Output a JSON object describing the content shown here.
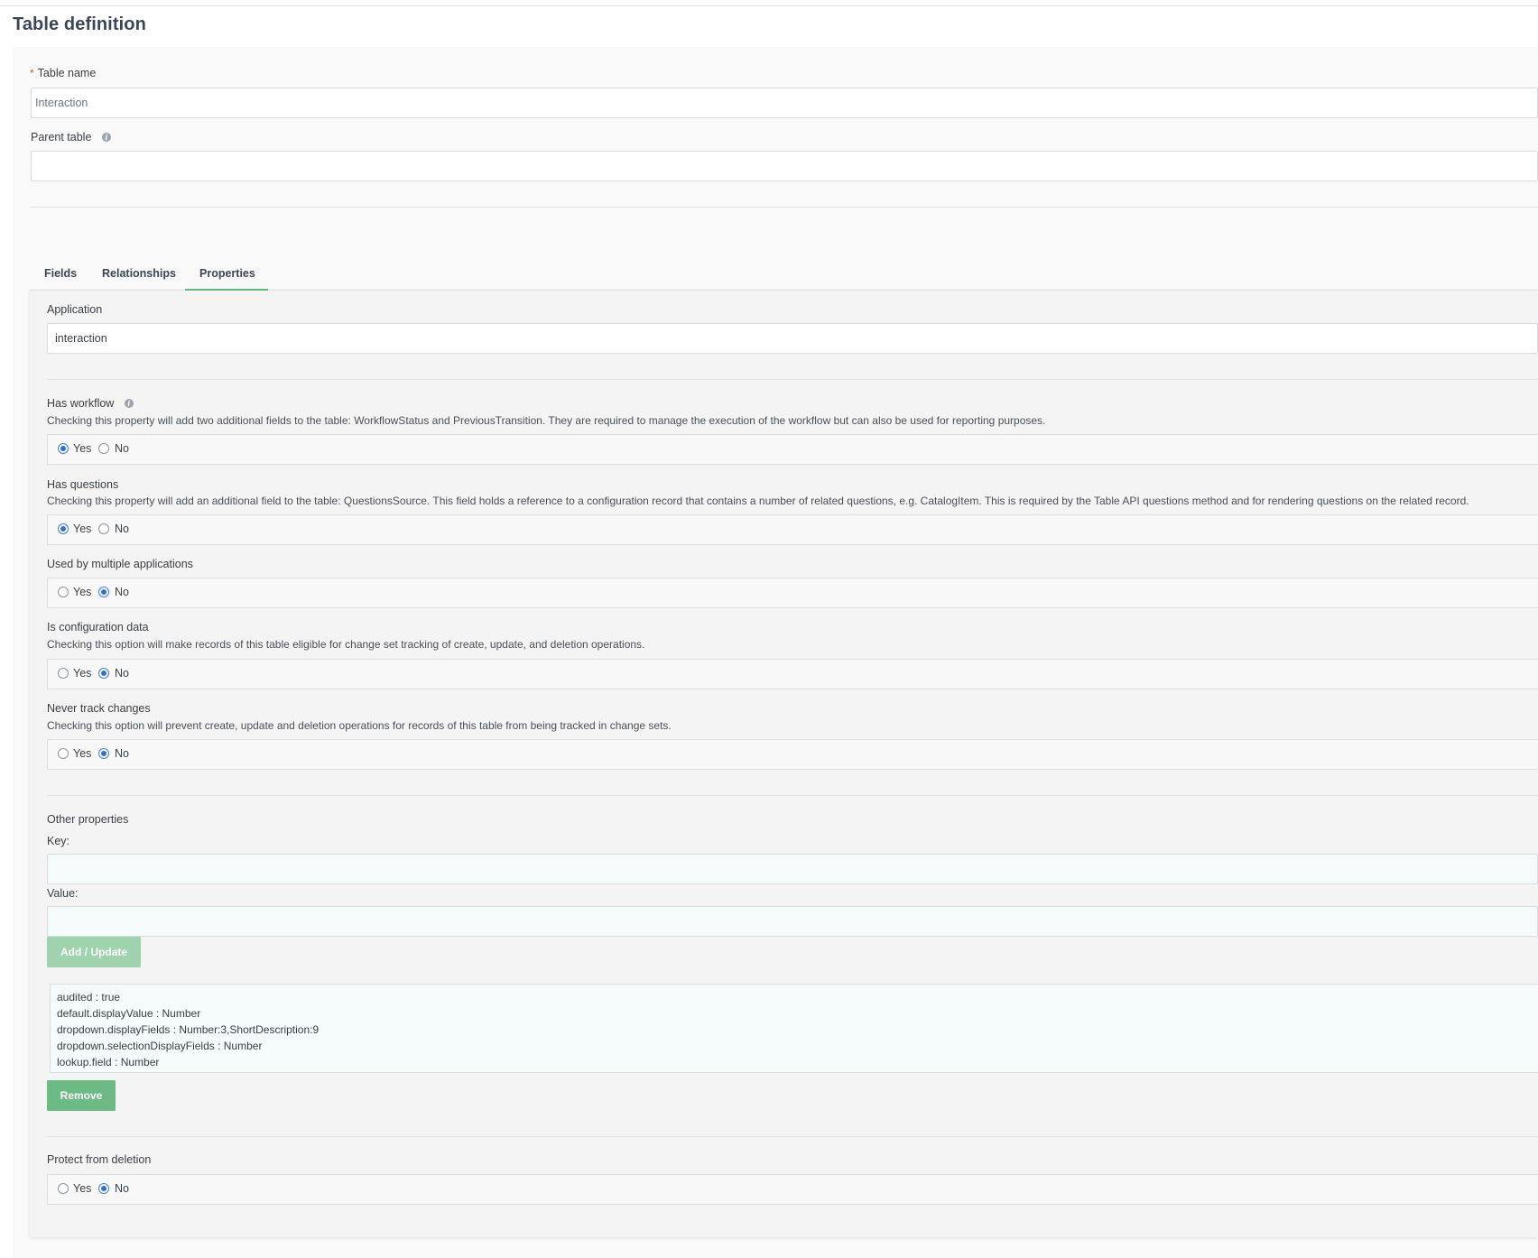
{
  "page": {
    "title": "Table definition"
  },
  "table_name": {
    "label": "Table name",
    "required_marker": "*",
    "value": "Interaction"
  },
  "parent_table": {
    "label": "Parent table",
    "value": ""
  },
  "tabs": [
    {
      "label": "Fields",
      "active": false
    },
    {
      "label": "Relationships",
      "active": false
    },
    {
      "label": "Properties",
      "active": true
    }
  ],
  "properties": {
    "application": {
      "label": "Application",
      "value": "interaction"
    },
    "has_workflow": {
      "label": "Has workflow",
      "description": "Checking this property will add two additional fields to the table: WorkflowStatus and PreviousTransition. They are required to manage the execution of the workflow but can also be used for reporting purposes.",
      "selected": "Yes"
    },
    "has_questions": {
      "label": "Has questions",
      "description": "Checking this property will add an additional field to the table: QuestionsSource. This field holds a reference to a configuration record that contains a number of related questions, e.g. CatalogItem. This is required by the Table API questions method and for rendering questions on the related record.",
      "selected": "Yes"
    },
    "used_by_multiple": {
      "label": "Used by multiple applications",
      "selected": "No"
    },
    "is_configuration_data": {
      "label": "Is configuration data",
      "description": "Checking this option will make records of this table eligible for change set tracking of create, update, and deletion operations.",
      "selected": "No"
    },
    "never_track_changes": {
      "label": "Never track changes",
      "description": "Checking this option will prevent create, update and deletion operations for records of this table from being tracked in change sets.",
      "selected": "No"
    },
    "other_properties": {
      "label": "Other properties",
      "key_label": "Key:",
      "key_value": "",
      "value_label": "Value:",
      "value_value": "",
      "add_button": "Add / Update",
      "items": [
        "audited : true",
        "default.displayValue : Number",
        "dropdown.displayFields : Number:3,ShortDescription:9",
        "dropdown.selectionDisplayFields : Number",
        "lookup.field : Number"
      ],
      "remove_button": "Remove"
    },
    "protect_from_deletion": {
      "label": "Protect from deletion",
      "selected": "No"
    }
  },
  "radio_labels": {
    "yes": "Yes",
    "no": "No"
  },
  "colors": {
    "accent_green": "#5fb77c",
    "button_green": "#6cba84",
    "radio_blue": "#2f6fd6",
    "required_red": "#e05a2b"
  }
}
